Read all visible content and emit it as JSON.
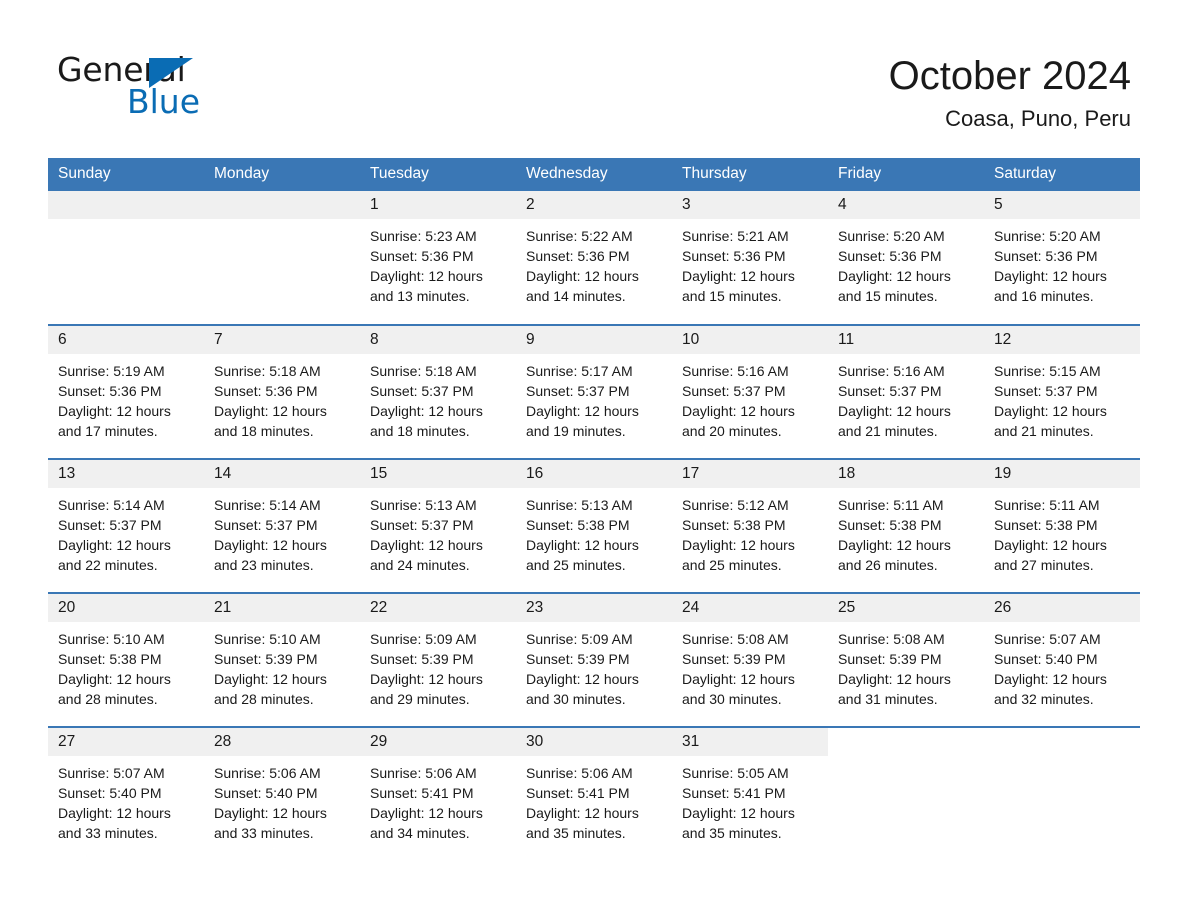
{
  "brand": {
    "name_part1": "General",
    "name_part2": "Blue",
    "triangle_icon": "triangle-icon",
    "accent_color": "#0a6cb4"
  },
  "header": {
    "title": "October 2024",
    "subtitle": "Coasa, Puno, Peru"
  },
  "theme": {
    "header_blue": "#3a77b5",
    "daynum_band": "#f0f0f0",
    "text": "#1a1a1a"
  },
  "calendar": {
    "weekday_headers": [
      "Sunday",
      "Monday",
      "Tuesday",
      "Wednesday",
      "Thursday",
      "Friday",
      "Saturday"
    ],
    "labels": {
      "sunrise": "Sunrise:",
      "sunset": "Sunset:",
      "daylight": "Daylight:"
    },
    "weeks": [
      [
        {
          "day": "",
          "empty": true
        },
        {
          "day": "",
          "empty": true
        },
        {
          "day": "1",
          "sunrise": "Sunrise: 5:23 AM",
          "sunset": "Sunset: 5:36 PM",
          "daylight": "Daylight: 12 hours and 13 minutes."
        },
        {
          "day": "2",
          "sunrise": "Sunrise: 5:22 AM",
          "sunset": "Sunset: 5:36 PM",
          "daylight": "Daylight: 12 hours and 14 minutes."
        },
        {
          "day": "3",
          "sunrise": "Sunrise: 5:21 AM",
          "sunset": "Sunset: 5:36 PM",
          "daylight": "Daylight: 12 hours and 15 minutes."
        },
        {
          "day": "4",
          "sunrise": "Sunrise: 5:20 AM",
          "sunset": "Sunset: 5:36 PM",
          "daylight": "Daylight: 12 hours and 15 minutes."
        },
        {
          "day": "5",
          "sunrise": "Sunrise: 5:20 AM",
          "sunset": "Sunset: 5:36 PM",
          "daylight": "Daylight: 12 hours and 16 minutes."
        }
      ],
      [
        {
          "day": "6",
          "sunrise": "Sunrise: 5:19 AM",
          "sunset": "Sunset: 5:36 PM",
          "daylight": "Daylight: 12 hours and 17 minutes."
        },
        {
          "day": "7",
          "sunrise": "Sunrise: 5:18 AM",
          "sunset": "Sunset: 5:36 PM",
          "daylight": "Daylight: 12 hours and 18 minutes."
        },
        {
          "day": "8",
          "sunrise": "Sunrise: 5:18 AM",
          "sunset": "Sunset: 5:37 PM",
          "daylight": "Daylight: 12 hours and 18 minutes."
        },
        {
          "day": "9",
          "sunrise": "Sunrise: 5:17 AM",
          "sunset": "Sunset: 5:37 PM",
          "daylight": "Daylight: 12 hours and 19 minutes."
        },
        {
          "day": "10",
          "sunrise": "Sunrise: 5:16 AM",
          "sunset": "Sunset: 5:37 PM",
          "daylight": "Daylight: 12 hours and 20 minutes."
        },
        {
          "day": "11",
          "sunrise": "Sunrise: 5:16 AM",
          "sunset": "Sunset: 5:37 PM",
          "daylight": "Daylight: 12 hours and 21 minutes."
        },
        {
          "day": "12",
          "sunrise": "Sunrise: 5:15 AM",
          "sunset": "Sunset: 5:37 PM",
          "daylight": "Daylight: 12 hours and 21 minutes."
        }
      ],
      [
        {
          "day": "13",
          "sunrise": "Sunrise: 5:14 AM",
          "sunset": "Sunset: 5:37 PM",
          "daylight": "Daylight: 12 hours and 22 minutes."
        },
        {
          "day": "14",
          "sunrise": "Sunrise: 5:14 AM",
          "sunset": "Sunset: 5:37 PM",
          "daylight": "Daylight: 12 hours and 23 minutes."
        },
        {
          "day": "15",
          "sunrise": "Sunrise: 5:13 AM",
          "sunset": "Sunset: 5:37 PM",
          "daylight": "Daylight: 12 hours and 24 minutes."
        },
        {
          "day": "16",
          "sunrise": "Sunrise: 5:13 AM",
          "sunset": "Sunset: 5:38 PM",
          "daylight": "Daylight: 12 hours and 25 minutes."
        },
        {
          "day": "17",
          "sunrise": "Sunrise: 5:12 AM",
          "sunset": "Sunset: 5:38 PM",
          "daylight": "Daylight: 12 hours and 25 minutes."
        },
        {
          "day": "18",
          "sunrise": "Sunrise: 5:11 AM",
          "sunset": "Sunset: 5:38 PM",
          "daylight": "Daylight: 12 hours and 26 minutes."
        },
        {
          "day": "19",
          "sunrise": "Sunrise: 5:11 AM",
          "sunset": "Sunset: 5:38 PM",
          "daylight": "Daylight: 12 hours and 27 minutes."
        }
      ],
      [
        {
          "day": "20",
          "sunrise": "Sunrise: 5:10 AM",
          "sunset": "Sunset: 5:38 PM",
          "daylight": "Daylight: 12 hours and 28 minutes."
        },
        {
          "day": "21",
          "sunrise": "Sunrise: 5:10 AM",
          "sunset": "Sunset: 5:39 PM",
          "daylight": "Daylight: 12 hours and 28 minutes."
        },
        {
          "day": "22",
          "sunrise": "Sunrise: 5:09 AM",
          "sunset": "Sunset: 5:39 PM",
          "daylight": "Daylight: 12 hours and 29 minutes."
        },
        {
          "day": "23",
          "sunrise": "Sunrise: 5:09 AM",
          "sunset": "Sunset: 5:39 PM",
          "daylight": "Daylight: 12 hours and 30 minutes."
        },
        {
          "day": "24",
          "sunrise": "Sunrise: 5:08 AM",
          "sunset": "Sunset: 5:39 PM",
          "daylight": "Daylight: 12 hours and 30 minutes."
        },
        {
          "day": "25",
          "sunrise": "Sunrise: 5:08 AM",
          "sunset": "Sunset: 5:39 PM",
          "daylight": "Daylight: 12 hours and 31 minutes."
        },
        {
          "day": "26",
          "sunrise": "Sunrise: 5:07 AM",
          "sunset": "Sunset: 5:40 PM",
          "daylight": "Daylight: 12 hours and 32 minutes."
        }
      ],
      [
        {
          "day": "27",
          "sunrise": "Sunrise: 5:07 AM",
          "sunset": "Sunset: 5:40 PM",
          "daylight": "Daylight: 12 hours and 33 minutes."
        },
        {
          "day": "28",
          "sunrise": "Sunrise: 5:06 AM",
          "sunset": "Sunset: 5:40 PM",
          "daylight": "Daylight: 12 hours and 33 minutes."
        },
        {
          "day": "29",
          "sunrise": "Sunrise: 5:06 AM",
          "sunset": "Sunset: 5:41 PM",
          "daylight": "Daylight: 12 hours and 34 minutes."
        },
        {
          "day": "30",
          "sunrise": "Sunrise: 5:06 AM",
          "sunset": "Sunset: 5:41 PM",
          "daylight": "Daylight: 12 hours and 35 minutes."
        },
        {
          "day": "31",
          "sunrise": "Sunrise: 5:05 AM",
          "sunset": "Sunset: 5:41 PM",
          "daylight": "Daylight: 12 hours and 35 minutes."
        },
        {
          "day": "",
          "empty": true,
          "trailing": true
        },
        {
          "day": "",
          "empty": true,
          "trailing": true
        }
      ]
    ]
  }
}
